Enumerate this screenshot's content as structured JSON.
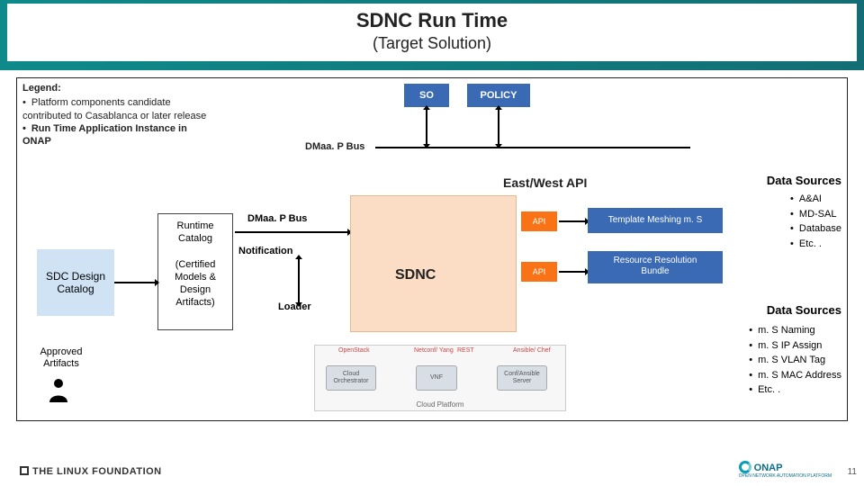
{
  "header": {
    "title": "SDNC Run Time",
    "subtitle": "(Target Solution)"
  },
  "legend": {
    "heading": "Legend:",
    "items": [
      "Platform components candidate contributed to Casablanca or later release",
      "Run Time Application Instance in ONAP"
    ]
  },
  "boxes": {
    "so": "SO",
    "policy": "POLICY",
    "sdc": "SDC Design Catalog",
    "runtime_title": "Runtime Catalog",
    "runtime_sub": "(Certified Models & Design Artifacts)",
    "sdnc": "SDNC",
    "template_meshing": "Template Meshing m. S",
    "resource_bundle_l1": "Resource Resolution",
    "resource_bundle_l2": "Bundle",
    "api": "API"
  },
  "labels": {
    "dmaap_bus": "DMaa. P Bus",
    "east_west": "East/West API",
    "notification": "Notification",
    "loader": "Loader",
    "approved": "Approved Artifacts",
    "cloud_platform": "Cloud Platform",
    "cloud_orch": "Cloud Orchestrator",
    "vnf": "VNF",
    "conf": "Conf/Ansible Server",
    "openstack": "OpenStack",
    "netconf": "Netconf/ Yang",
    "rest": "REST",
    "ansible": "Ansible/ Chef"
  },
  "data_sources_1": {
    "heading": "Data Sources",
    "items": [
      "A&AI",
      "MD-SAL",
      "Database",
      "Etc. ."
    ]
  },
  "data_sources_2": {
    "heading": "Data Sources",
    "items": [
      "m. S Naming",
      "m. S IP Assign",
      "m. S VLAN Tag",
      "m. S MAC Address",
      "Etc. ."
    ]
  },
  "footer": {
    "linux": "THE LINUX FOUNDATION",
    "onap": "ONAP",
    "onap_sub": "OPEN NETWORK AUTOMATION PLATFORM",
    "page": "11"
  }
}
